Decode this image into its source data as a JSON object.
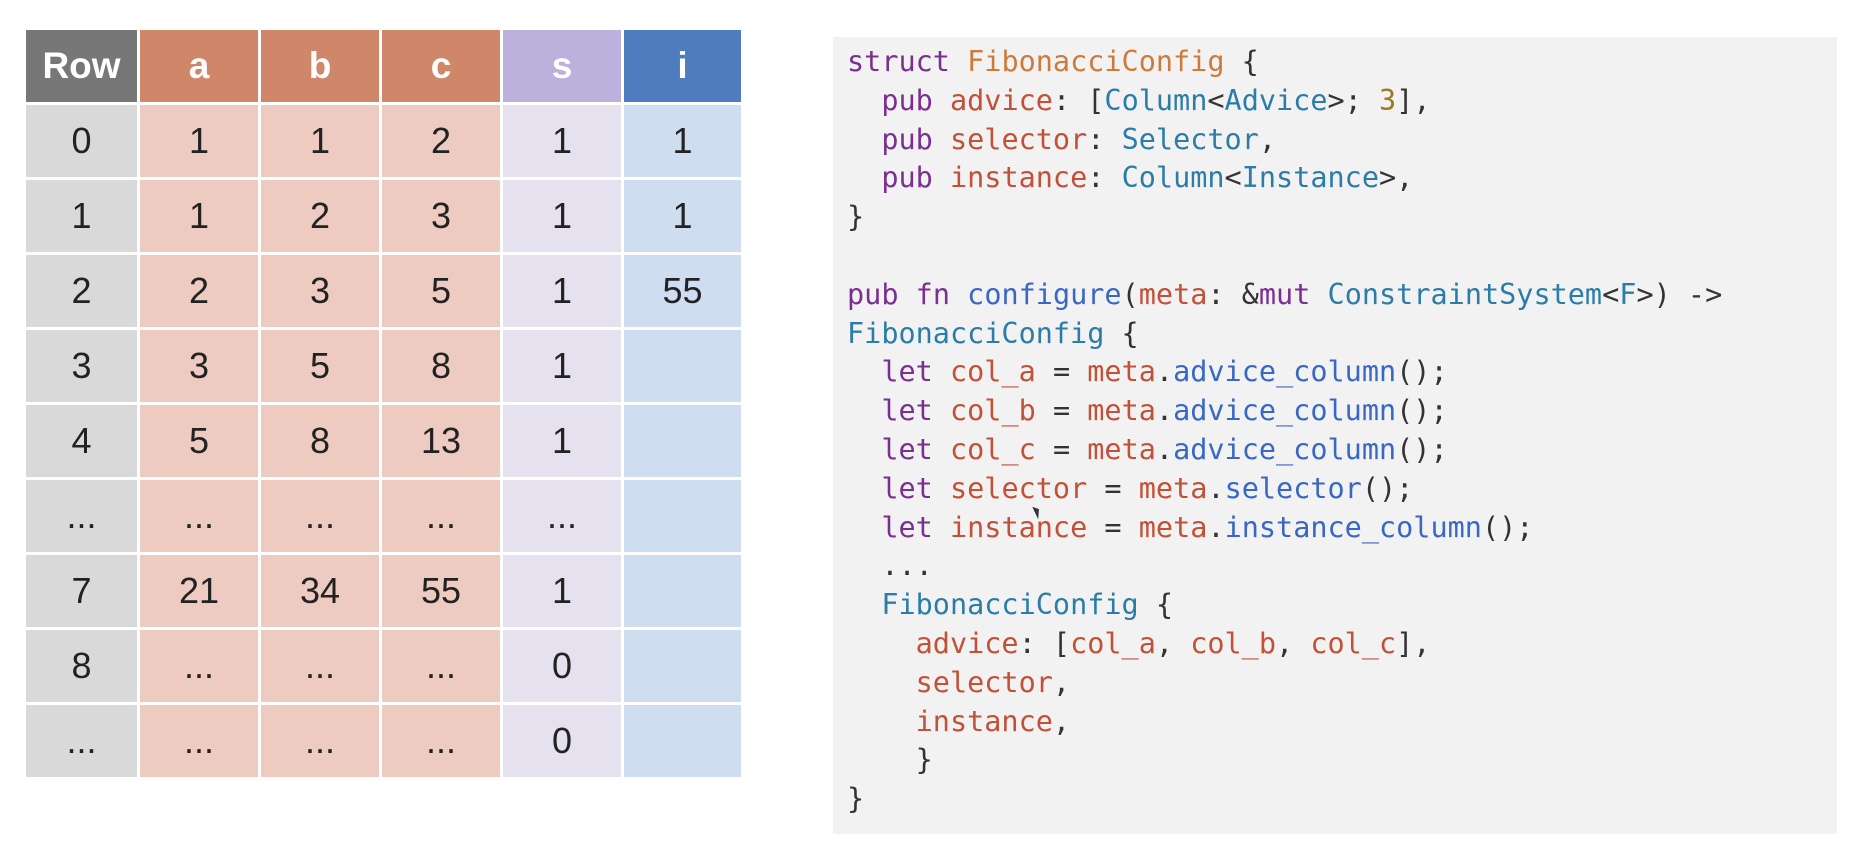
{
  "table": {
    "headers": [
      "Row",
      "a",
      "b",
      "c",
      "s",
      "i"
    ],
    "rows": [
      [
        "0",
        "1",
        "1",
        "2",
        "1",
        "1"
      ],
      [
        "1",
        "1",
        "2",
        "3",
        "1",
        "1"
      ],
      [
        "2",
        "2",
        "3",
        "5",
        "1",
        "55"
      ],
      [
        "3",
        "3",
        "5",
        "8",
        "1",
        ""
      ],
      [
        "4",
        "5",
        "8",
        "13",
        "1",
        ""
      ],
      [
        "...",
        "...",
        "...",
        "...",
        "...",
        ""
      ],
      [
        "7",
        "21",
        "34",
        "55",
        "1",
        ""
      ],
      [
        "8",
        "...",
        "...",
        "...",
        "0",
        ""
      ],
      [
        "...",
        "...",
        "...",
        "...",
        "0",
        ""
      ]
    ],
    "colors": {
      "row_header": "#777777",
      "abc_header": "#d08668",
      "s_header": "#bcb1dc",
      "i_header": "#4f7bbf",
      "row_body": "#d9d9d9",
      "abc_body": "#edcbc1",
      "s_body": "#e6e1ef",
      "i_body": "#cfddf1"
    }
  },
  "code": {
    "lines": [
      [
        [
          "kw",
          "struct"
        ],
        [
          "pun",
          " "
        ],
        [
          "cls",
          "FibonacciConfig"
        ],
        [
          "pun",
          " {"
        ]
      ],
      [
        [
          "pun",
          "  "
        ],
        [
          "kw",
          "pub"
        ],
        [
          "pun",
          " "
        ],
        [
          "var",
          "advice"
        ],
        [
          "pun",
          ": ["
        ],
        [
          "ty",
          "Column"
        ],
        [
          "pun",
          "<"
        ],
        [
          "ty",
          "Advice"
        ],
        [
          "pun",
          ">; "
        ],
        [
          "num",
          "3"
        ],
        [
          "pun",
          "],"
        ]
      ],
      [
        [
          "pun",
          "  "
        ],
        [
          "kw",
          "pub"
        ],
        [
          "pun",
          " "
        ],
        [
          "var",
          "selector"
        ],
        [
          "pun",
          ": "
        ],
        [
          "ty",
          "Selector"
        ],
        [
          "pun",
          ","
        ]
      ],
      [
        [
          "pun",
          "  "
        ],
        [
          "kw",
          "pub"
        ],
        [
          "pun",
          " "
        ],
        [
          "var",
          "instance"
        ],
        [
          "pun",
          ": "
        ],
        [
          "ty",
          "Column"
        ],
        [
          "pun",
          "<"
        ],
        [
          "ty",
          "Instance"
        ],
        [
          "pun",
          ">,"
        ]
      ],
      [
        [
          "pun",
          "}"
        ]
      ],
      [
        [
          "pun",
          ""
        ]
      ],
      [
        [
          "kw",
          "pub"
        ],
        [
          "pun",
          " "
        ],
        [
          "kw",
          "fn"
        ],
        [
          "pun",
          " "
        ],
        [
          "fn",
          "configure"
        ],
        [
          "pun",
          "("
        ],
        [
          "var",
          "meta"
        ],
        [
          "pun",
          ": &"
        ],
        [
          "kw",
          "mut"
        ],
        [
          "pun",
          " "
        ],
        [
          "ty",
          "ConstraintSystem"
        ],
        [
          "pun",
          "<"
        ],
        [
          "ty",
          "F"
        ],
        [
          "pun",
          ">) ->"
        ]
      ],
      [
        [
          "ty",
          "FibonacciConfig"
        ],
        [
          "pun",
          " {"
        ]
      ],
      [
        [
          "pun",
          "  "
        ],
        [
          "kw",
          "let"
        ],
        [
          "pun",
          " "
        ],
        [
          "var",
          "col_a"
        ],
        [
          "pun",
          " = "
        ],
        [
          "var",
          "meta"
        ],
        [
          "pun",
          "."
        ],
        [
          "fn",
          "advice_column"
        ],
        [
          "pun",
          "();"
        ]
      ],
      [
        [
          "pun",
          "  "
        ],
        [
          "kw",
          "let"
        ],
        [
          "pun",
          " "
        ],
        [
          "var",
          "col_b"
        ],
        [
          "pun",
          " = "
        ],
        [
          "var",
          "meta"
        ],
        [
          "pun",
          "."
        ],
        [
          "fn",
          "advice_column"
        ],
        [
          "pun",
          "();"
        ]
      ],
      [
        [
          "pun",
          "  "
        ],
        [
          "kw",
          "let"
        ],
        [
          "pun",
          " "
        ],
        [
          "var",
          "col_c"
        ],
        [
          "pun",
          " = "
        ],
        [
          "var",
          "meta"
        ],
        [
          "pun",
          "."
        ],
        [
          "fn",
          "advice_column"
        ],
        [
          "pun",
          "();"
        ]
      ],
      [
        [
          "pun",
          "  "
        ],
        [
          "kw",
          "let"
        ],
        [
          "pun",
          " "
        ],
        [
          "var",
          "selector"
        ],
        [
          "pun",
          " = "
        ],
        [
          "var",
          "meta"
        ],
        [
          "pun",
          "."
        ],
        [
          "fn",
          "selector"
        ],
        [
          "pun",
          "();"
        ]
      ],
      [
        [
          "pun",
          "  "
        ],
        [
          "kw",
          "let"
        ],
        [
          "pun",
          " "
        ],
        [
          "var",
          "instance"
        ],
        [
          "pun",
          " = "
        ],
        [
          "var",
          "meta"
        ],
        [
          "pun",
          "."
        ],
        [
          "fn",
          "instance_column"
        ],
        [
          "pun",
          "();"
        ]
      ],
      [
        [
          "pun",
          "  ..."
        ]
      ],
      [
        [
          "pun",
          "  "
        ],
        [
          "ty",
          "FibonacciConfig"
        ],
        [
          "pun",
          " {"
        ]
      ],
      [
        [
          "pun",
          "    "
        ],
        [
          "var",
          "advice"
        ],
        [
          "pun",
          ": ["
        ],
        [
          "var",
          "col_a"
        ],
        [
          "pun",
          ", "
        ],
        [
          "var",
          "col_b"
        ],
        [
          "pun",
          ", "
        ],
        [
          "var",
          "col_c"
        ],
        [
          "pun",
          "],"
        ]
      ],
      [
        [
          "pun",
          "    "
        ],
        [
          "var",
          "selector"
        ],
        [
          "pun",
          ","
        ]
      ],
      [
        [
          "pun",
          "    "
        ],
        [
          "var",
          "instance"
        ],
        [
          "pun",
          ","
        ]
      ],
      [
        [
          "pun",
          "    }"
        ]
      ],
      [
        [
          "pun",
          "}"
        ]
      ]
    ]
  }
}
